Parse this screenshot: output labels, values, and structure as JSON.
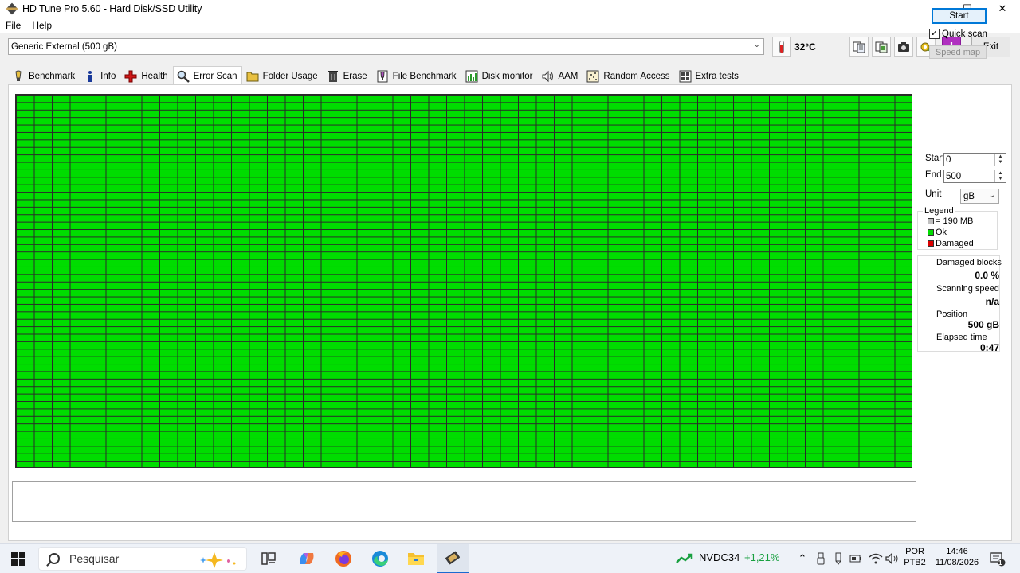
{
  "window": {
    "title": "HD Tune Pro 5.60 - Hard Disk/SSD Utility",
    "controls": {
      "minimize": "—",
      "maximize": "☐",
      "close": "✕"
    }
  },
  "menu": {
    "file": "File",
    "help": "Help"
  },
  "toolbar": {
    "drive": "Generic External (500 gB)",
    "temperature": "32°C",
    "exit_label": "Exit",
    "buttons": [
      "copy-info-icon",
      "copy-screenshot-icon",
      "camera-icon",
      "options-icon",
      "save-icon"
    ]
  },
  "tabs": [
    {
      "label": "Benchmark",
      "icon": "benchmark-icon"
    },
    {
      "label": "Info",
      "icon": "info-icon"
    },
    {
      "label": "Health",
      "icon": "health-icon"
    },
    {
      "label": "Error Scan",
      "icon": "error-scan-icon",
      "active": true
    },
    {
      "label": "Folder Usage",
      "icon": "folder-icon"
    },
    {
      "label": "Erase",
      "icon": "erase-icon"
    },
    {
      "label": "File Benchmark",
      "icon": "file-benchmark-icon"
    },
    {
      "label": "Disk monitor",
      "icon": "disk-monitor-icon"
    },
    {
      "label": "AAM",
      "icon": "speaker-icon"
    },
    {
      "label": "Random Access",
      "icon": "random-access-icon"
    },
    {
      "label": "Extra tests",
      "icon": "extra-tests-icon"
    }
  ],
  "scan": {
    "start_label": "Start",
    "quick_scan_label": "Quick scan",
    "quick_scan_checked": true,
    "speed_map_label": "Speed map",
    "start_field_label": "Start",
    "start_value": "0",
    "end_field_label": "End",
    "end_value": "500",
    "unit_label": "Unit",
    "unit_value": "gB",
    "legend": {
      "title": "Legend",
      "block_size": "= 190 MB",
      "ok": "Ok",
      "damaged": "Damaged",
      "colors": {
        "block": "#c0c0c0",
        "ok": "#00dd00",
        "damaged": "#dd0000"
      }
    },
    "stats": {
      "damaged_blocks_label": "Damaged blocks",
      "damaged_blocks_value": "0.0 %",
      "scanning_speed_label": "Scanning speed",
      "scanning_speed_value": "n/a",
      "position_label": "Position",
      "position_value": "500 gB",
      "elapsed_label": "Elapsed time",
      "elapsed_value": "0:47"
    },
    "grid_status": "all blocks ok",
    "grid_color": "#00dd00"
  },
  "taskbar": {
    "search_placeholder": "Pesquisar",
    "stock_ticker": "NVDC34",
    "stock_change": "+1,21%",
    "language": "POR",
    "keyboard": "PTB2",
    "time": "14:46",
    "date": "11/08/2026",
    "notification_count": "1"
  }
}
